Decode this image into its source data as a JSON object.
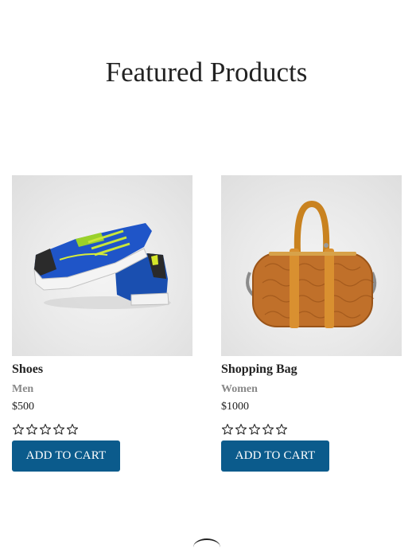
{
  "section": {
    "title": "Featured Products"
  },
  "products": [
    {
      "name": "Shoes",
      "category": "Men",
      "price": "$500",
      "rating": 0,
      "rating_max": 5,
      "image_icon": "sneakers-image",
      "cart_label": "ADD TO CART"
    },
    {
      "name": "Shopping Bag",
      "category": "Women",
      "price": "$1000",
      "rating": 0,
      "rating_max": 5,
      "image_icon": "handbag-image",
      "cart_label": "ADD TO CART"
    }
  ],
  "colors": {
    "button_bg": "#0b5b8c",
    "button_text": "#ffffff",
    "category_text": "#888888"
  }
}
